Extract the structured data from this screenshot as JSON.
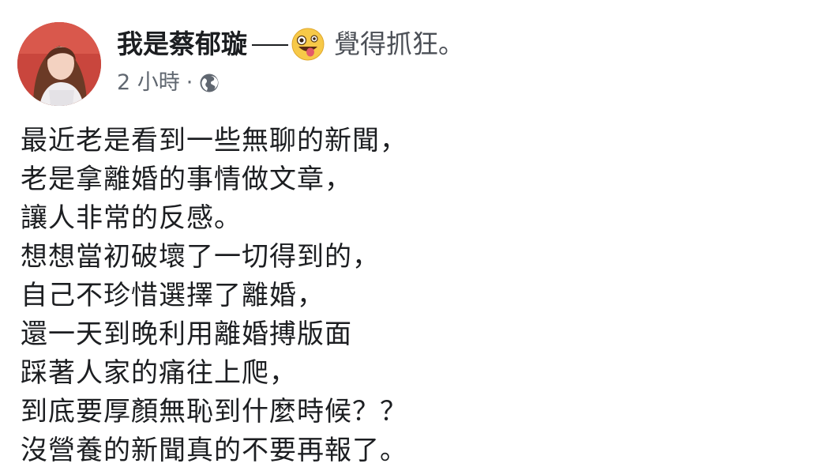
{
  "post": {
    "author": "我是蔡郁璇",
    "feeling": "覺得抓狂。",
    "feeling_icon": "crazy-face-emoji",
    "timestamp": "2 小時",
    "meta_separator": "·",
    "privacy_icon": "globe-icon",
    "body_lines": [
      "最近老是看到一些無聊的新聞，",
      "老是拿離婚的事情做文章，",
      "讓人非常的反感。",
      "想想當初破壞了一切得到的，",
      "自己不珍惜選擇了離婚，",
      "還一天到晚利用離婚搏版面",
      "踩著人家的痛往上爬，",
      "到底要厚顏無恥到什麼時候？？",
      "沒營養的新聞真的不要再報了。"
    ]
  },
  "colors": {
    "text": "#1c1e21",
    "secondary_text": "#606770",
    "emoji_yellow": "#f7c948"
  }
}
